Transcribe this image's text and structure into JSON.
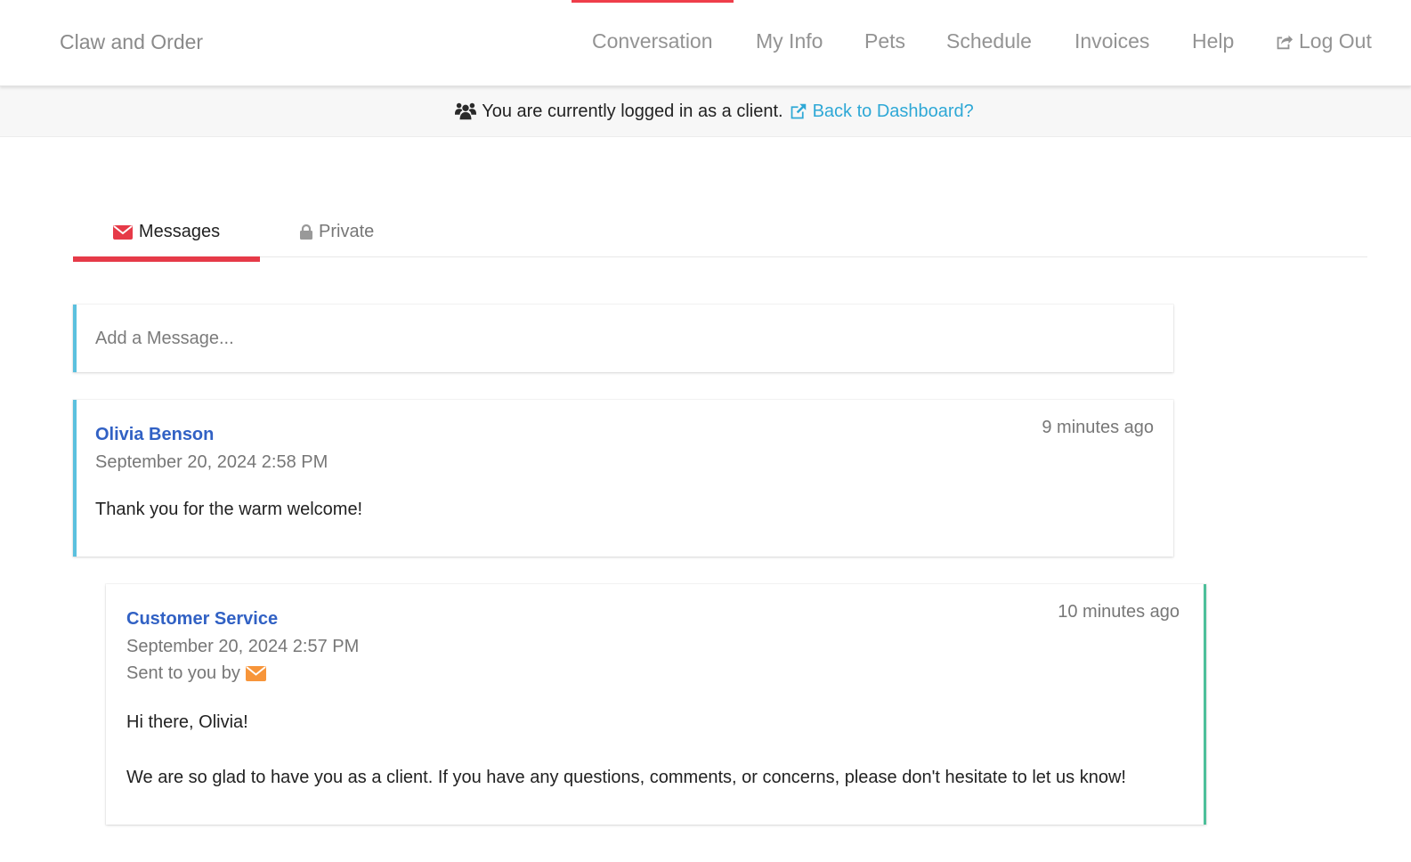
{
  "navbar": {
    "brand": "Claw and Order",
    "items": [
      {
        "label": "Conversation",
        "active": true
      },
      {
        "label": "My Info"
      },
      {
        "label": "Pets"
      },
      {
        "label": "Schedule"
      },
      {
        "label": "Invoices"
      },
      {
        "label": "Help"
      },
      {
        "label": "Log Out",
        "icon": "share-square-icon"
      }
    ],
    "active_color": "#ef3e4a"
  },
  "alert": {
    "icon": "users-icon",
    "text": "You are currently logged in as a client.",
    "link_icon": "external-link-icon",
    "link_label": "Back to Dashboard?",
    "link_color": "#2ea8d6"
  },
  "tabs": [
    {
      "label": "Messages",
      "icon": "envelope-icon",
      "active": true,
      "icon_color": "#e63a48"
    },
    {
      "label": "Private",
      "icon": "lock-icon",
      "active": false
    }
  ],
  "compose": {
    "placeholder": "Add a Message...",
    "value": ""
  },
  "messages": [
    {
      "author": "Olivia Benson",
      "date": "September 20, 2024 2:58 PM",
      "relative_time": "9 minutes ago",
      "body": [
        "Thank you for the warm welcome!"
      ],
      "accent_color": "#5bc0de"
    },
    {
      "author": "Customer Service",
      "date": "September 20, 2024 2:57 PM",
      "sent_by_label": "Sent to you by",
      "sent_by_icon": "envelope-icon",
      "sent_by_icon_color": "#f7953a",
      "relative_time": "10 minutes ago",
      "body": [
        "Hi there, Olivia!",
        "We are so glad to have you as a client. If you have any questions, comments, or concerns, please don't hesitate to let us know!"
      ],
      "accent_color": "#4dbf9a"
    }
  ]
}
